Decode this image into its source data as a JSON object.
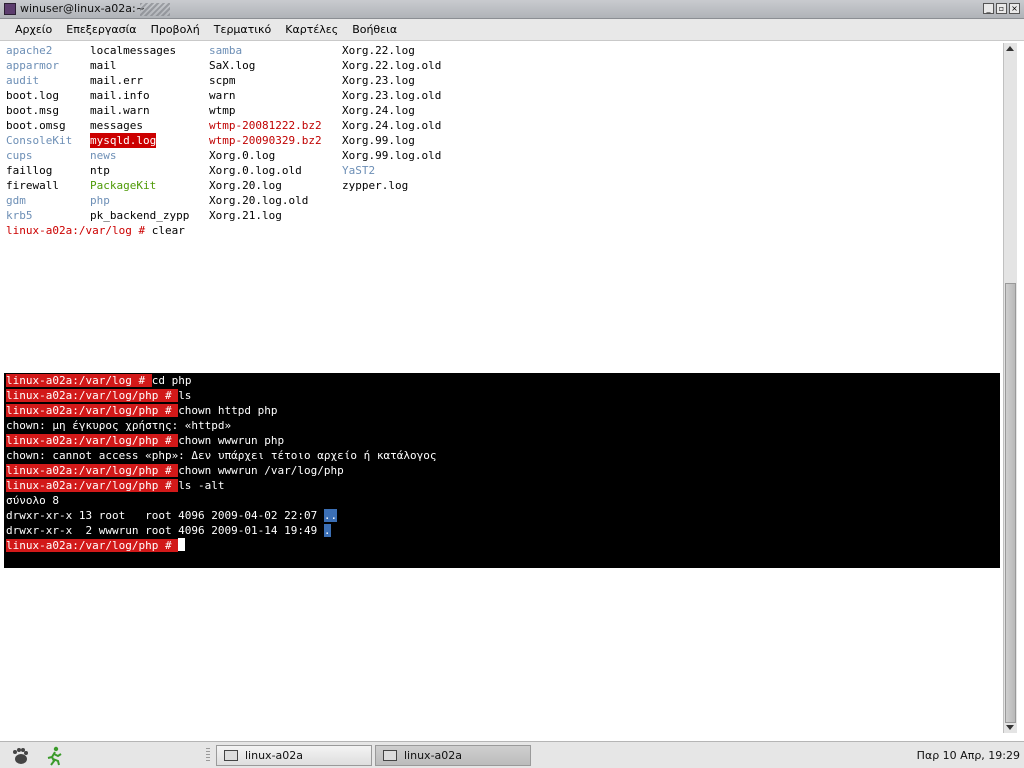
{
  "window": {
    "title": "winuser@linux-a02a:~"
  },
  "menu": [
    "Αρχείο",
    "Επεξεργασία",
    "Προβολή",
    "Τερματικό",
    "Καρτέλες",
    "Βοήθεια"
  ],
  "listing": [
    [
      {
        "t": "apache2",
        "k": "dir"
      },
      {
        "t": "localmessages",
        "k": ""
      },
      {
        "t": "samba",
        "k": "dir"
      },
      {
        "t": "Xorg.22.log",
        "k": ""
      }
    ],
    [
      {
        "t": "apparmor",
        "k": "dir"
      },
      {
        "t": "mail",
        "k": ""
      },
      {
        "t": "SaX.log",
        "k": ""
      },
      {
        "t": "Xorg.22.log.old",
        "k": ""
      }
    ],
    [
      {
        "t": "audit",
        "k": "dir"
      },
      {
        "t": "mail.err",
        "k": ""
      },
      {
        "t": "scpm",
        "k": ""
      },
      {
        "t": "Xorg.23.log",
        "k": ""
      }
    ],
    [
      {
        "t": "boot.log",
        "k": ""
      },
      {
        "t": "mail.info",
        "k": ""
      },
      {
        "t": "warn",
        "k": ""
      },
      {
        "t": "Xorg.23.log.old",
        "k": ""
      }
    ],
    [
      {
        "t": "boot.msg",
        "k": ""
      },
      {
        "t": "mail.warn",
        "k": ""
      },
      {
        "t": "wtmp",
        "k": ""
      },
      {
        "t": "Xorg.24.log",
        "k": ""
      }
    ],
    [
      {
        "t": "boot.omsg",
        "k": ""
      },
      {
        "t": "messages",
        "k": ""
      },
      {
        "t": "wtmp-20081222.bz2",
        "k": "red"
      },
      {
        "t": "Xorg.24.log.old",
        "k": ""
      }
    ],
    [
      {
        "t": "ConsoleKit",
        "k": "dir"
      },
      {
        "t": "mysqld.log",
        "k": "hl"
      },
      {
        "t": "wtmp-20090329.bz2",
        "k": "red"
      },
      {
        "t": "Xorg.99.log",
        "k": ""
      }
    ],
    [
      {
        "t": "cups",
        "k": "dir"
      },
      {
        "t": "news",
        "k": "dir"
      },
      {
        "t": "Xorg.0.log",
        "k": ""
      },
      {
        "t": "Xorg.99.log.old",
        "k": ""
      }
    ],
    [
      {
        "t": "faillog",
        "k": ""
      },
      {
        "t": "ntp",
        "k": ""
      },
      {
        "t": "Xorg.0.log.old",
        "k": ""
      },
      {
        "t": "YaST2",
        "k": "dir"
      }
    ],
    [
      {
        "t": "firewall",
        "k": ""
      },
      {
        "t": "PackageKit",
        "k": "grn"
      },
      {
        "t": "Xorg.20.log",
        "k": ""
      },
      {
        "t": "zypper.log",
        "k": ""
      }
    ],
    [
      {
        "t": "gdm",
        "k": "dir"
      },
      {
        "t": "php",
        "k": "dir"
      },
      {
        "t": "Xorg.20.log.old",
        "k": ""
      },
      {
        "t": "",
        "k": ""
      }
    ],
    [
      {
        "t": "krb5",
        "k": "dir"
      },
      {
        "t": "pk_backend_zypp",
        "k": ""
      },
      {
        "t": "Xorg.21.log",
        "k": ""
      },
      {
        "t": "",
        "k": ""
      }
    ]
  ],
  "clear_line": {
    "prompt": "linux-a02a:/var/log # ",
    "cmd": "clear"
  },
  "session": [
    {
      "prompt": "linux-a02a:/var/log # ",
      "text": "cd php"
    },
    {
      "prompt": "linux-a02a:/var/log/php # ",
      "text": "ls"
    },
    {
      "prompt": "linux-a02a:/var/log/php # ",
      "text": "chown httpd php"
    },
    {
      "prompt": "",
      "text": "chown: μη έγκυρος χρήστης: «httpd»"
    },
    {
      "prompt": "linux-a02a:/var/log/php # ",
      "text": "chown wwwrun php"
    },
    {
      "prompt": "",
      "text": "chown: cannot access «php»: Δεν υπάρχει τέτοιο αρχείο ή κατάλογος"
    },
    {
      "prompt": "linux-a02a:/var/log/php # ",
      "text": "chown wwwrun /var/log/php"
    },
    {
      "prompt": "linux-a02a:/var/log/php # ",
      "text": "ls -alt"
    },
    {
      "prompt": "",
      "text": "σύνολο 8"
    },
    {
      "prompt": "",
      "text": "drwxr-xr-x 13 root   root 4096 2009-04-02 22:07 ",
      "sel": ".."
    },
    {
      "prompt": "",
      "text": "drwxr-xr-x  2 wwwrun root 4096 2009-01-14 19:49 ",
      "sel": "."
    },
    {
      "prompt": "linux-a02a:/var/log/php # ",
      "text": "",
      "cursor": true
    }
  ],
  "taskbar": {
    "tasks": [
      "linux-a02a",
      "linux-a02a"
    ],
    "clock": "Παρ 10 Απρ, 19:29",
    "icons": [
      "gnome-foot-icon",
      "runner-icon"
    ]
  }
}
